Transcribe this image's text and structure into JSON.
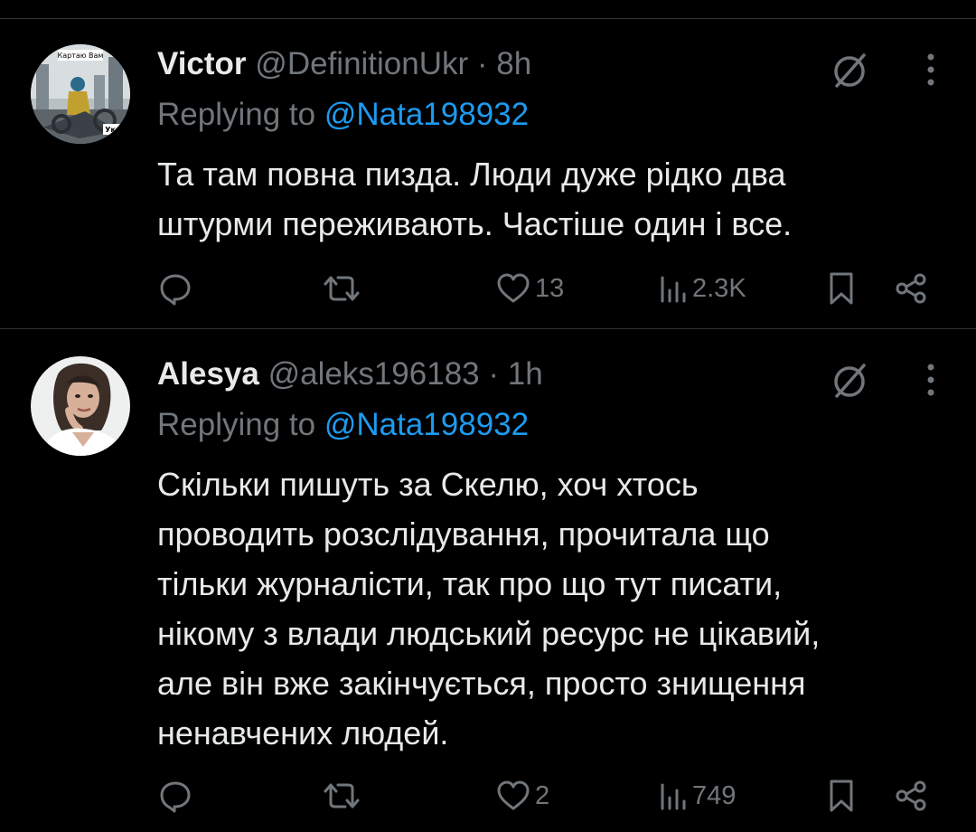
{
  "colors": {
    "background": "#000000",
    "text_primary": "#e7e9ea",
    "text_secondary": "#71767b",
    "accent": "#1d9bf0",
    "divider": "#2f3336"
  },
  "tweets": [
    {
      "name": "Victor",
      "handle": "@DefinitionUkr",
      "separator": "·",
      "time": "8h",
      "reply_prefix": "Replying to",
      "reply_to": "@Nata198932",
      "body_lines": [
        "Та там повна пизда. Люди дуже рідко два",
        "штурми переживають. Частіше один і все."
      ],
      "replies": "",
      "retweets": "",
      "likes": "13",
      "views": "2.3K",
      "avatar_text_top": "Картаю Вам",
      "avatar_text_badge": "Украї"
    },
    {
      "name": "Alesya",
      "handle": "@aleks196183",
      "separator": "·",
      "time": "1h",
      "reply_prefix": "Replying to",
      "reply_to": "@Nata198932",
      "body_lines": [
        "Скільки пишуть за Скелю, хоч хтось",
        "проводить розслідування, прочитала що",
        "тільки журналісти, так про що тут писати,",
        "нікому з влади людський ресурс не цікавий,",
        "але він вже закінчується, просто знищення",
        "ненавчених людей."
      ],
      "replies": "",
      "retweets": "",
      "likes": "2",
      "views": "749"
    }
  ],
  "icons": [
    "grok-icon",
    "more-icon",
    "reply-icon",
    "retweet-icon",
    "like-icon",
    "views-icon",
    "bookmark-icon",
    "share-icon"
  ]
}
